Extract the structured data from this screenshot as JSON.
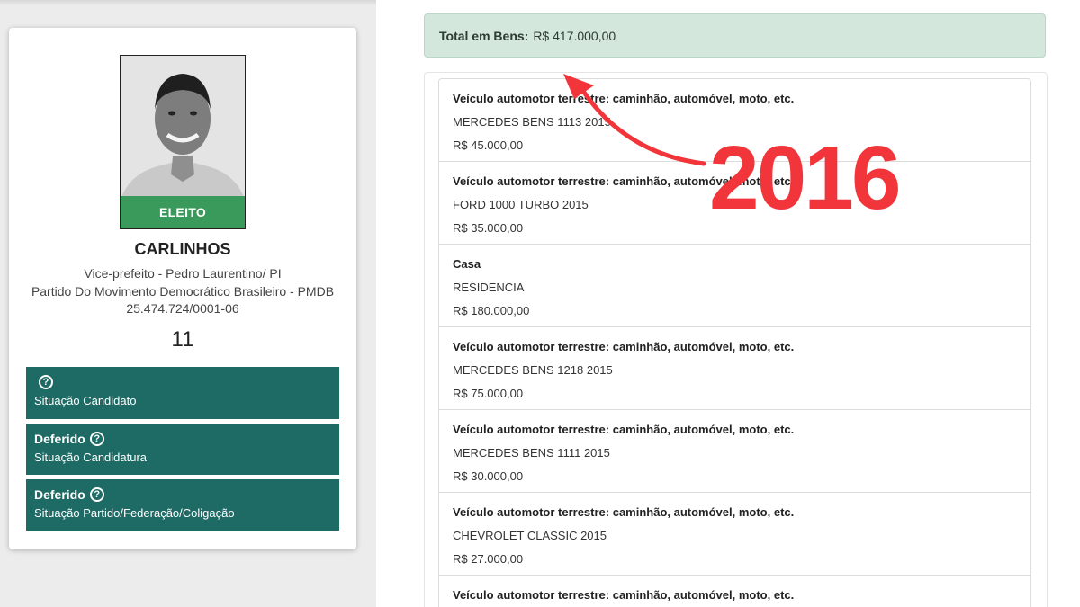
{
  "candidate": {
    "status_banner": "ELEITO",
    "name": "CARLINHOS",
    "role": "Vice-prefeito - Pedro Laurentino/ PI",
    "party": "Partido Do Movimento Democrático Brasileiro - PMDB",
    "cnpj": "25.474.724/0001-06",
    "number": "11",
    "status_boxes": [
      {
        "value": "",
        "label": "Situação Candidato"
      },
      {
        "value": "Deferido",
        "label": "Situação Candidatura"
      },
      {
        "value": "Deferido",
        "label": "Situação Partido/Federação/Coligação"
      }
    ]
  },
  "total": {
    "label": "Total em Bens:",
    "value": "R$ 417.000,00"
  },
  "assets": [
    {
      "type": "Veículo automotor terrestre: caminhão, automóvel, moto, etc.",
      "description": "MERCEDES BENS 1113 2015",
      "value": "R$ 45.000,00"
    },
    {
      "type": "Veículo automotor terrestre: caminhão, automóvel, moto, etc.",
      "description": "FORD 1000 TURBO 2015",
      "value": "R$ 35.000,00"
    },
    {
      "type": "Casa",
      "description": "RESIDENCIA",
      "value": "R$ 180.000,00"
    },
    {
      "type": "Veículo automotor terrestre: caminhão, automóvel, moto, etc.",
      "description": "MERCEDES BENS 1218 2015",
      "value": "R$ 75.000,00"
    },
    {
      "type": "Veículo automotor terrestre: caminhão, automóvel, moto, etc.",
      "description": "MERCEDES BENS 1111 2015",
      "value": "R$ 30.000,00"
    },
    {
      "type": "Veículo automotor terrestre: caminhão, automóvel, moto, etc.",
      "description": "CHEVROLET CLASSIC 2015",
      "value": "R$ 27.000,00"
    },
    {
      "type": "Veículo automotor terrestre: caminhão, automóvel, moto, etc.",
      "description": "",
      "value": ""
    }
  ],
  "annotation": {
    "year": "2016",
    "color": "#f2353a"
  },
  "icons": {
    "help": "question-circle-icon",
    "photo": "candidate-photo",
    "arrow": "curved-arrow-icon"
  },
  "colors": {
    "status_box": "#1e6a64",
    "eleito": "#3a9a5c",
    "total_bg": "#d3e7dc"
  }
}
